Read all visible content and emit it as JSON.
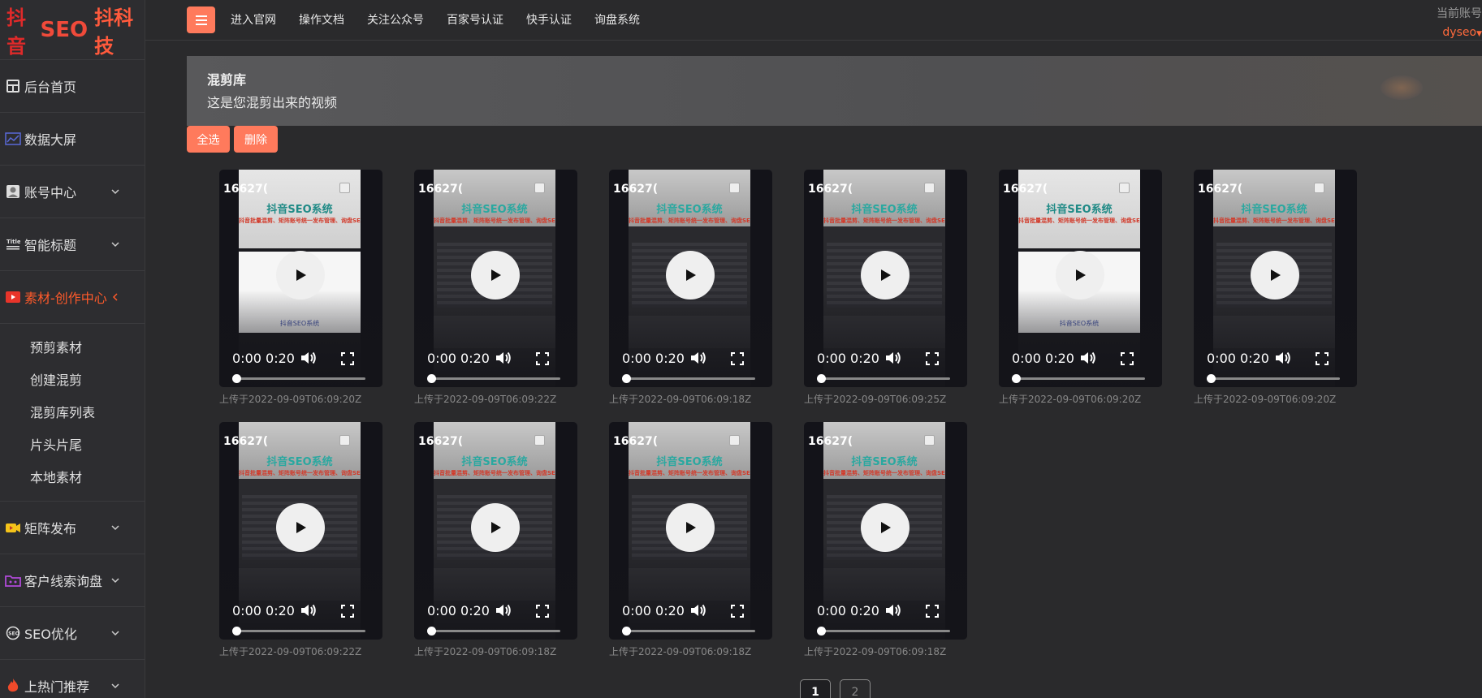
{
  "brand": {
    "part1": "抖音",
    "part2": "SEO",
    "part3": "抖科技"
  },
  "sidebar": {
    "items": [
      {
        "label": "后台首页",
        "icon": "dashboard-icon"
      },
      {
        "label": "数据大屏",
        "icon": "chart-icon"
      },
      {
        "label": "账号中心",
        "icon": "user-icon"
      },
      {
        "label": "智能标题",
        "icon": "title-icon"
      },
      {
        "label": "素材-创作中心",
        "icon": "video-icon"
      },
      {
        "label": "矩阵发布",
        "icon": "camera-icon"
      },
      {
        "label": "客户线索询盘",
        "icon": "folder-icon"
      },
      {
        "label": "SEO优化",
        "icon": "seo-icon"
      },
      {
        "label": "上热门推荐",
        "icon": "fire-icon"
      }
    ],
    "sub_items": [
      "预剪素材",
      "创建混剪",
      "混剪库列表",
      "片头片尾",
      "本地素材"
    ]
  },
  "topbar": {
    "links": [
      "进入官网",
      "操作文档",
      "关注公众号",
      "百家号认证",
      "快手认证",
      "询盘系统"
    ],
    "account_title": "当前账号",
    "account_user": "dyseo"
  },
  "banner": {
    "title": "混剪库",
    "subtitle": "这是您混剪出来的视频"
  },
  "actions": {
    "select_all": "全选",
    "delete": "删除"
  },
  "video_overlay": {
    "title": "抖音SEO系统",
    "slogan": "抖音批量混剪、矩阵账号统一发布管理、询盘SEO系统",
    "footer": "抖音SEO系统"
  },
  "videos": [
    {
      "id": "16627(",
      "time": "0:00 0:20",
      "caption": "上传于2022-09-09T06:09:20Z",
      "style": "white"
    },
    {
      "id": "16627(",
      "time": "0:00 0:20",
      "caption": "上传于2022-09-09T06:09:22Z",
      "style": "dark"
    },
    {
      "id": "16627(",
      "time": "0:00 0:20",
      "caption": "上传于2022-09-09T06:09:18Z",
      "style": "dark"
    },
    {
      "id": "16627(",
      "time": "0:00 0:20",
      "caption": "上传于2022-09-09T06:09:25Z",
      "style": "dark"
    },
    {
      "id": "16627(",
      "time": "0:00 0:20",
      "caption": "上传于2022-09-09T06:09:20Z",
      "style": "white"
    },
    {
      "id": "16627(",
      "time": "0:00 0:20",
      "caption": "上传于2022-09-09T06:09:20Z",
      "style": "dark"
    },
    {
      "id": "16627(",
      "time": "0:00 0:20",
      "caption": "上传于2022-09-09T06:09:22Z",
      "style": "dark"
    },
    {
      "id": "16627(",
      "time": "0:00 0:20",
      "caption": "上传于2022-09-09T06:09:18Z",
      "style": "dark"
    },
    {
      "id": "16627(",
      "time": "0:00 0:20",
      "caption": "上传于2022-09-09T06:09:18Z",
      "style": "dark"
    },
    {
      "id": "16627(",
      "time": "0:00 0:20",
      "caption": "上传于2022-09-09T06:09:18Z",
      "style": "dark"
    }
  ],
  "pagination": {
    "pages": [
      "1",
      "2"
    ],
    "current": "1"
  },
  "colors": {
    "accent": "#ff7a5c",
    "active": "#ff5a2a",
    "background": "#2a2a2c"
  }
}
